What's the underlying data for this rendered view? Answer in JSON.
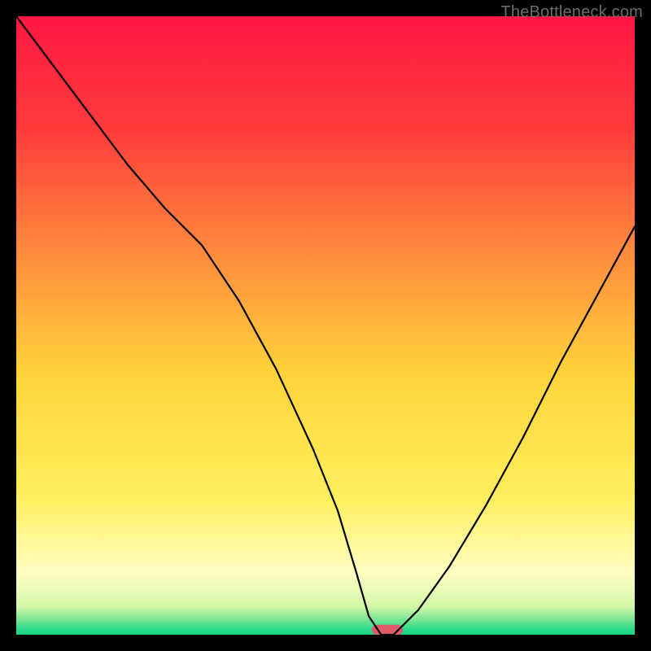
{
  "watermark": "TheBottleneck.com",
  "chart_data": {
    "type": "line",
    "title": "",
    "xlabel": "",
    "ylabel": "",
    "xlim": [
      0,
      100
    ],
    "ylim": [
      0,
      100
    ],
    "grid": false,
    "legend": false,
    "background": {
      "type": "vertical-gradient",
      "stops": [
        {
          "pos": 0.0,
          "color": "#ff1744"
        },
        {
          "pos": 0.18,
          "color": "#ff3b3b"
        },
        {
          "pos": 0.38,
          "color": "#ff8a3d"
        },
        {
          "pos": 0.58,
          "color": "#ffd43b"
        },
        {
          "pos": 0.78,
          "color": "#ffef5e"
        },
        {
          "pos": 0.9,
          "color": "#fffec2"
        },
        {
          "pos": 0.955,
          "color": "#d2f7a8"
        },
        {
          "pos": 0.975,
          "color": "#7be695"
        },
        {
          "pos": 0.99,
          "color": "#2fd98a"
        },
        {
          "pos": 1.0,
          "color": "#17d184"
        }
      ]
    },
    "series": [
      {
        "name": "bottleneck-curve",
        "color": "#000000",
        "stroke_width": 2.2,
        "x": [
          0,
          6,
          12,
          18,
          24,
          30,
          36,
          42,
          48,
          52,
          55,
          57,
          59,
          61,
          65,
          70,
          76,
          82,
          88,
          94,
          100
        ],
        "values": [
          100,
          92,
          84,
          76,
          69,
          63,
          54,
          43,
          30,
          20,
          10,
          3,
          0,
          0,
          4,
          11,
          21,
          32,
          44,
          55,
          66
        ]
      }
    ],
    "marker": {
      "name": "optimal-zone",
      "color": "#e05a6a",
      "shape": "pill",
      "x_center": 60,
      "y": 0,
      "width_x": 5,
      "height_y": 1.6
    }
  }
}
